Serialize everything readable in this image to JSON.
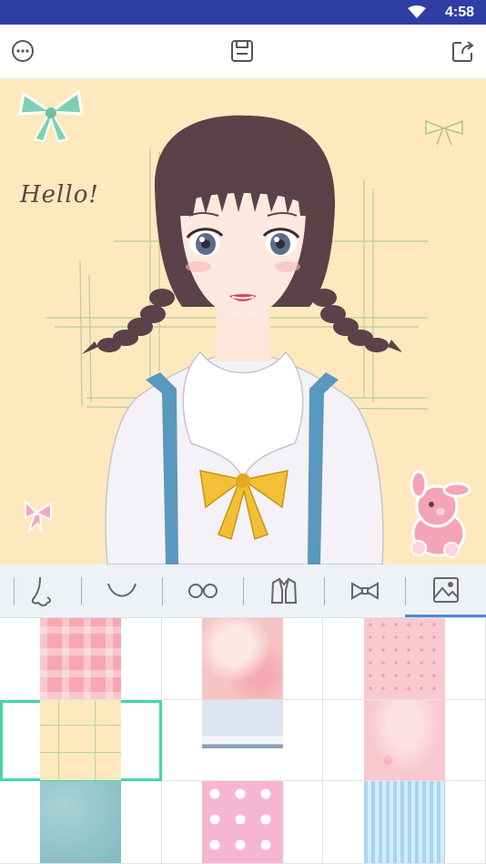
{
  "status": {
    "time": "4:58"
  },
  "canvas": {
    "greeting": "Hello!"
  },
  "tabs": [
    {
      "name": "nose",
      "icon": "nose-icon"
    },
    {
      "name": "mouth",
      "icon": "mouth-icon"
    },
    {
      "name": "glasses",
      "icon": "glasses-icon"
    },
    {
      "name": "clothes",
      "icon": "jacket-icon"
    },
    {
      "name": "accessories",
      "icon": "bow-icon"
    },
    {
      "name": "background",
      "icon": "image-icon",
      "active": true
    }
  ],
  "backgrounds": [
    {
      "name": "pink-plaid",
      "selected": false
    },
    {
      "name": "pink-watercolor",
      "selected": false
    },
    {
      "name": "pink-dots",
      "selected": false
    },
    {
      "name": "yellow-hello",
      "selected": true
    },
    {
      "name": "winter-gate",
      "selected": false
    },
    {
      "name": "pink-petals",
      "selected": false
    },
    {
      "name": "teal-texture",
      "selected": false
    },
    {
      "name": "pink-bunnies",
      "selected": false
    },
    {
      "name": "blue-stripes",
      "selected": false
    }
  ],
  "colors": {
    "statusbar": "#2f3ea3",
    "canvas_bg": "#fde9bd",
    "tab_active": "#4a8ad1",
    "selection": "#46d6a4"
  }
}
